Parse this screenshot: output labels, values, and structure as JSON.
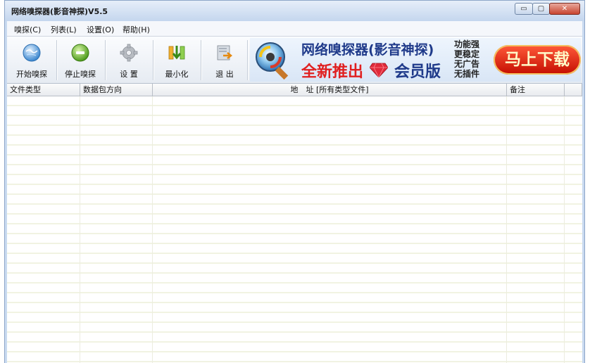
{
  "window": {
    "title": "网络嗅探器(影音神探)V5.5",
    "buttons": {
      "minimize": "▭",
      "maximize": "▢",
      "close": "✕"
    }
  },
  "menu": [
    {
      "label": "嗅探(C)"
    },
    {
      "label": "列表(L)"
    },
    {
      "label": "设置(O)"
    },
    {
      "label": "帮助(H)"
    }
  ],
  "toolbar": {
    "buttons": [
      {
        "label": "开始嗅探",
        "icon": "globe-icon"
      },
      {
        "label": "停止嗅探",
        "icon": "stop-icon"
      },
      {
        "label": "设 置",
        "icon": "gear-icon"
      },
      {
        "label": "最小化",
        "icon": "minimize-arrow-icon"
      },
      {
        "label": "退 出",
        "icon": "exit-icon"
      }
    ]
  },
  "banner": {
    "title": "网络嗅探器(影音神探)",
    "subtitle_left": "全新推出",
    "subtitle_right": "会员版",
    "features": [
      "功能强",
      "更稳定",
      "无广告",
      "无插件"
    ],
    "download_label": "马上下载",
    "colors": {
      "title": "#1f3a8a",
      "highlight": "#e02020"
    }
  },
  "table": {
    "columns": [
      "文件类型",
      "数据包方向",
      "地　址 [所有类型文件]",
      "备注"
    ],
    "rows": []
  }
}
